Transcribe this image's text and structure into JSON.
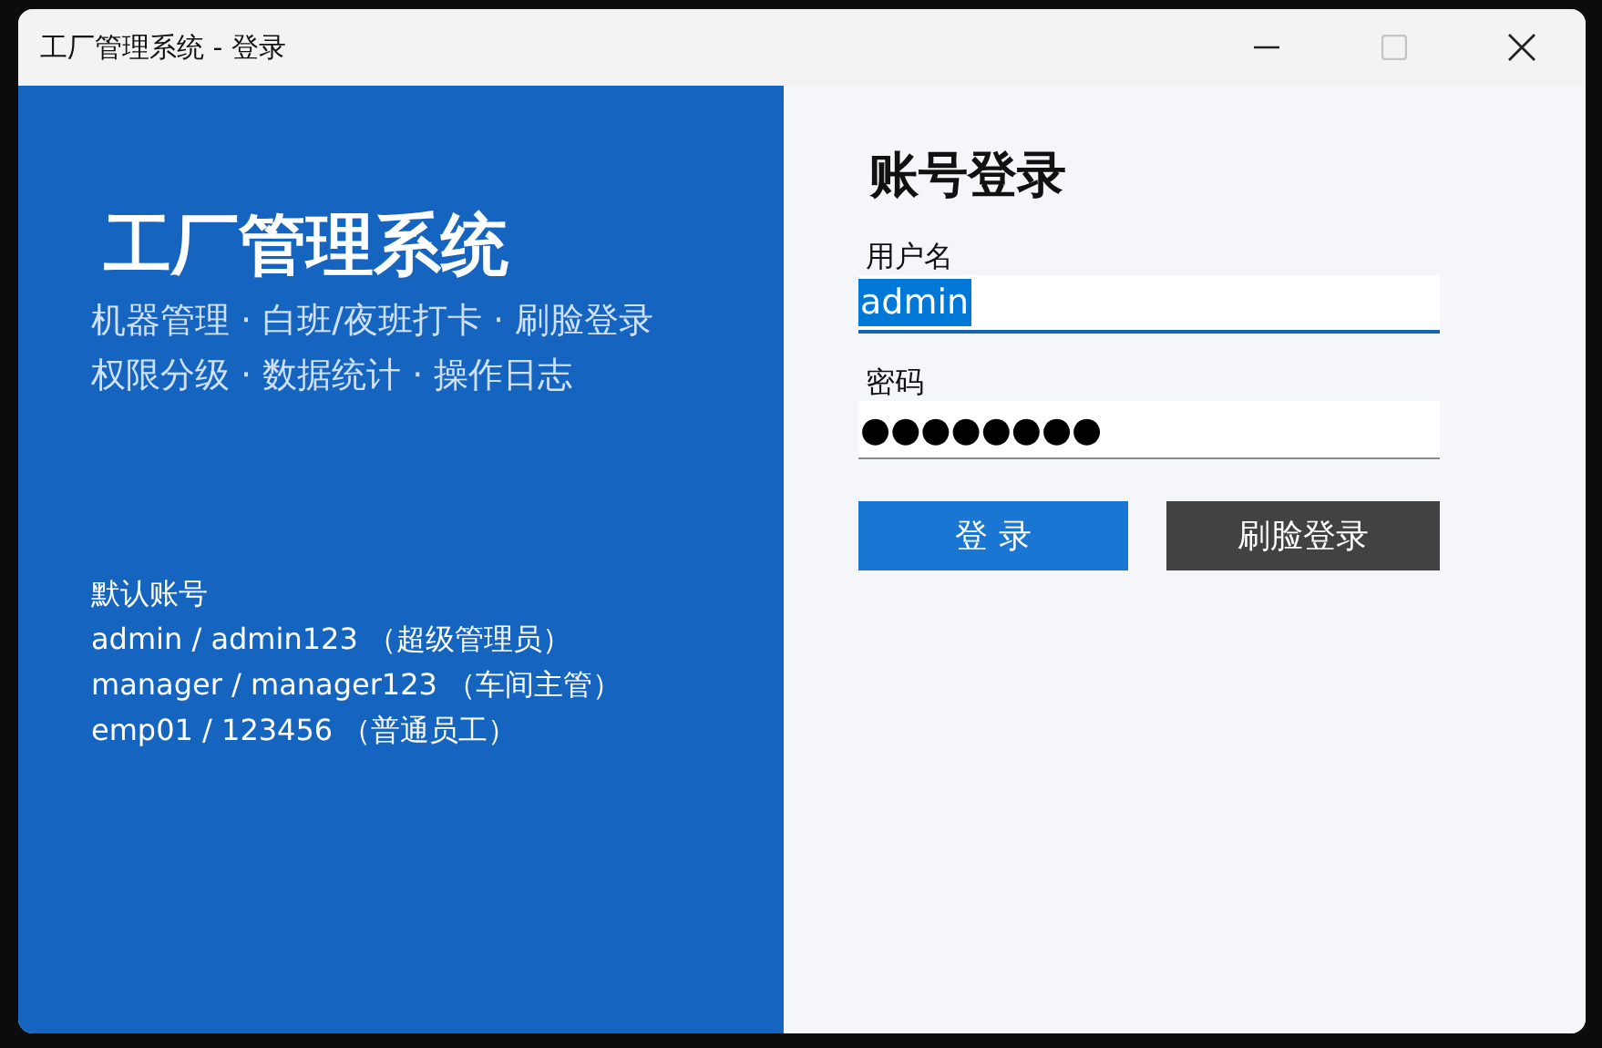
{
  "window": {
    "title": "工厂管理系统 - 登录",
    "maximize_disabled": true
  },
  "brand": {
    "title": "工厂管理系统",
    "features": [
      "机器管理 · 白班/夜班打卡 · 刷脸登录",
      "权限分级 · 数据统计 · 操作日志"
    ],
    "accounts_heading": "默认账号",
    "accounts": [
      "admin / admin123 （超级管理员）",
      "manager / manager123 （车间主管）",
      "emp01 / 123456 （普通员工）"
    ]
  },
  "login": {
    "heading": "账号登录",
    "fields": [
      {
        "label": "用户名",
        "value": "admin",
        "focused": true,
        "text_selected": true
      },
      {
        "label": "密码",
        "value": "●●●●●●●●",
        "focused": false,
        "text_selected": false
      }
    ],
    "buttons": [
      {
        "label": "登 录",
        "kind": "primary"
      },
      {
        "label": "刷脸登录",
        "kind": "secondary"
      }
    ]
  }
}
